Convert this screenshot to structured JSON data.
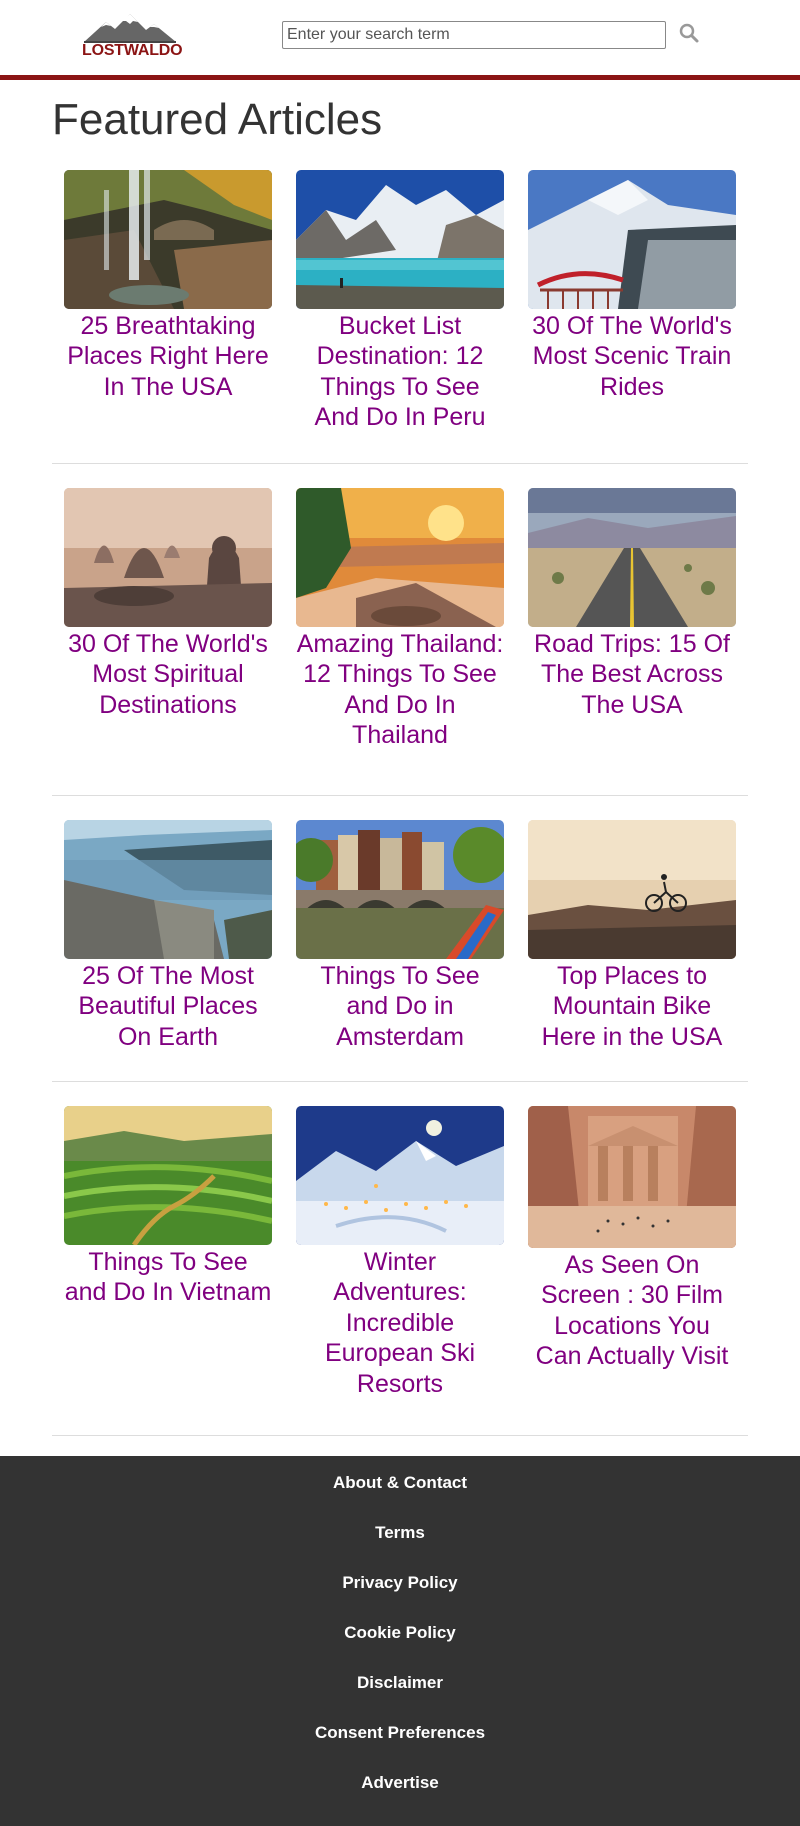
{
  "header": {
    "logo_text": "LOSTWALDO",
    "search_placeholder": "Enter your search term",
    "brand_color": "#8b1414"
  },
  "page_title": "Featured Articles",
  "articles": [
    {
      "title": "25 Breathtaking Places Right Here In The USA"
    },
    {
      "title": "Bucket List Destination: 12 Things To See And Do In Peru"
    },
    {
      "title": "30 Of The World's Most Scenic Train Rides"
    },
    {
      "title": "30 Of The World's Most Spiritual Destinations"
    },
    {
      "title": "Amazing Thailand: 12 Things To See And Do In Thailand"
    },
    {
      "title": "Road Trips: 15 Of The Best Across The USA"
    },
    {
      "title": "25 Of The Most Beautiful Places On Earth"
    },
    {
      "title": "Things To See and Do in Amsterdam"
    },
    {
      "title": "Top Places to Mountain Bike Here in the USA"
    },
    {
      "title": "Things To See and Do In Vietnam"
    },
    {
      "title": "Winter Adventures: Incredible European Ski Resorts"
    },
    {
      "title": "As Seen On Screen : 30 Film Locations You Can Actually Visit"
    }
  ],
  "footer": {
    "links": [
      "About & Contact",
      "Terms",
      "Privacy Policy",
      "Cookie Policy",
      "Disclaimer",
      "Consent Preferences",
      "Advertise"
    ]
  },
  "colors": {
    "link": "#800080",
    "footer_bg": "#333333"
  }
}
